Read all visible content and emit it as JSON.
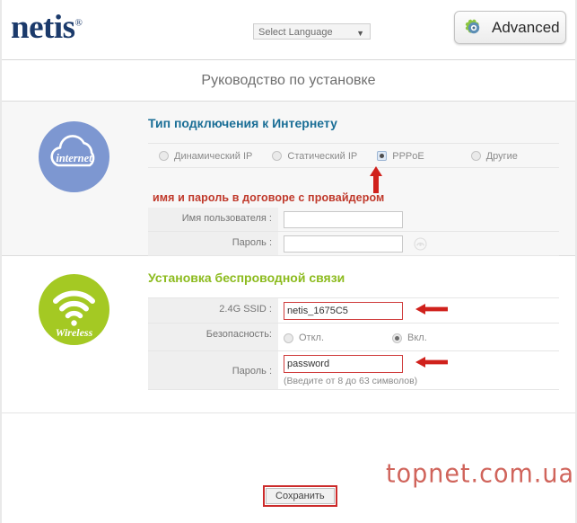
{
  "header": {
    "logo_text": "netis",
    "logo_reg": "®",
    "language_select_value": "Select Language",
    "advanced_label": "Advanced",
    "gear_icon": "gear-icon"
  },
  "page_title": "Руководство по установке",
  "internet": {
    "badge_label": "internet",
    "section_title": "Тип подключения к Интернету",
    "connection_types": [
      {
        "label": "Динамический IP",
        "selected": false
      },
      {
        "label": "Статический IP",
        "selected": false
      },
      {
        "label": "PPPoE",
        "selected": true
      },
      {
        "label": "Другие",
        "selected": false
      }
    ],
    "red_hint": "имя и пароль в договоре с провайдером",
    "username_label": "Имя пользователя :",
    "username_value": "",
    "password_label": "Пароль :",
    "password_value": "",
    "reveal_icon": "eye-icon"
  },
  "wireless": {
    "badge_label": "Wireless",
    "section_title": "Установка беспроводной связи",
    "ssid_label": "2.4G SSID :",
    "ssid_value": "netis_1675C5",
    "security_label": "Безопасность:",
    "security_options": [
      {
        "label": "Откл.",
        "selected": false
      },
      {
        "label": "Вкл.",
        "selected": true
      }
    ],
    "password_label": "Пароль :",
    "password_value": "password",
    "password_hint": "(Введите от 8 до 63 символов)"
  },
  "footer": {
    "save_label": "Сохранить",
    "watermark": "topnet.com.ua"
  },
  "colors": {
    "internet_blue": "#7d97d1",
    "wireless_green": "#a4c923",
    "heading_blue": "#1a6e96",
    "heading_green": "#8cbb1e",
    "annotation_red": "#c0392b",
    "logo_navy": "#1b3a6b"
  }
}
